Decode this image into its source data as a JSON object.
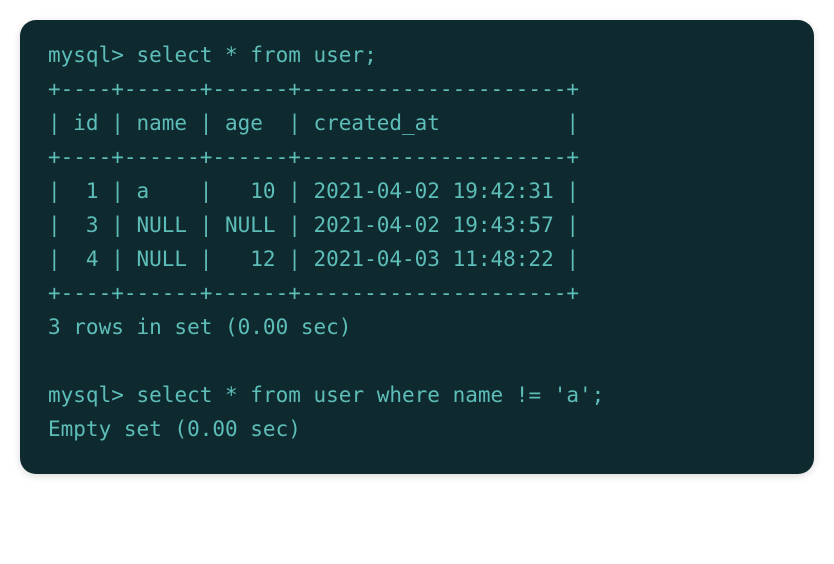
{
  "terminal": {
    "line1_prompt": "mysql> ",
    "line1_query": "select * from user;",
    "border_top": "+----+------+------+---------------------+",
    "header": "| id | name | age  | created_at          |",
    "border_mid": "+----+------+------+---------------------+",
    "row1": "|  1 | a    |   10 | 2021-04-02 19:42:31 |",
    "row2": "|  3 | NULL | NULL | 2021-04-02 19:43:57 |",
    "row3": "|  4 | NULL |   12 | 2021-04-03 11:48:22 |",
    "border_bot": "+----+------+------+---------------------+",
    "result1": "3 rows in set (0.00 sec)",
    "blank": "",
    "line2_prompt": "mysql> ",
    "line2_query": "select * from user where name != 'a';",
    "result2": "Empty set (0.00 sec)"
  },
  "table_data": {
    "columns": [
      "id",
      "name",
      "age",
      "created_at"
    ],
    "rows": [
      {
        "id": 1,
        "name": "a",
        "age": 10,
        "created_at": "2021-04-02 19:42:31"
      },
      {
        "id": 3,
        "name": null,
        "age": null,
        "created_at": "2021-04-02 19:43:57"
      },
      {
        "id": 4,
        "name": null,
        "age": 12,
        "created_at": "2021-04-03 11:48:22"
      }
    ]
  }
}
